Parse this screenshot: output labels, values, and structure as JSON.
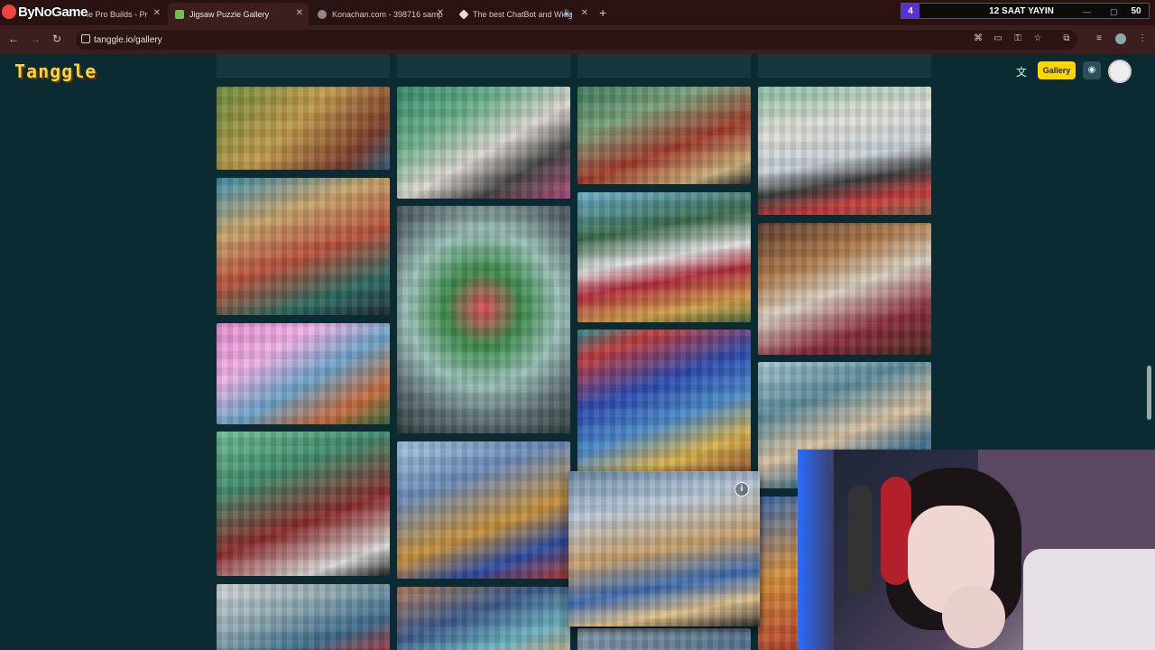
{
  "browser": {
    "brand_text": "ByNoGame",
    "tabs": [
      {
        "label": "le Pro Builds - Pr",
        "active": false
      },
      {
        "label": "Jigsaw Puzzle Gallery",
        "active": true
      },
      {
        "label": "Konachan.com - 398716 samp",
        "active": false
      },
      {
        "label": "The best ChatBot and Widg",
        "active": false
      }
    ],
    "url": "tanggle.io/gallery"
  },
  "stream_overlay": {
    "left_number": "4",
    "title": "12 SAAT YAYIN",
    "right_number": "50"
  },
  "site": {
    "logo_text": "Tanggle",
    "gallery_button": "Gallery",
    "info_icon_glyph": "i"
  },
  "colors": {
    "page_bg": "#0c2a32",
    "accent_yellow": "#ffd600",
    "tab_bar": "#2a1212",
    "address_bar": "#3d1e1e"
  }
}
